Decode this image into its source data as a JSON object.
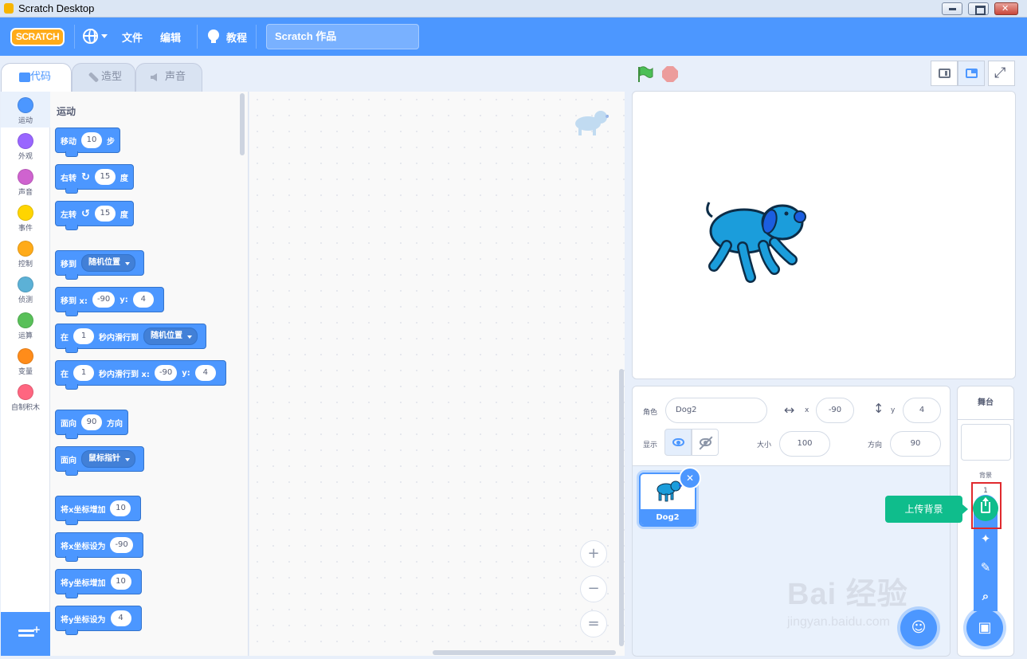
{
  "window": {
    "title": "Scratch Desktop"
  },
  "menubar": {
    "logo_text": "SCRATCH",
    "file_label": "文件",
    "edit_label": "编辑",
    "tutorials_label": "教程",
    "project_title": "Scratch 作品"
  },
  "tabs": {
    "code": "代码",
    "costumes": "造型",
    "sounds": "声音",
    "active": "code"
  },
  "categories": [
    {
      "label": "运动",
      "color": "#4c97ff"
    },
    {
      "label": "外观",
      "color": "#9966ff"
    },
    {
      "label": "声音",
      "color": "#cf63cf"
    },
    {
      "label": "事件",
      "color": "#ffd500"
    },
    {
      "label": "控制",
      "color": "#ffab19"
    },
    {
      "label": "侦测",
      "color": "#5cb1d6"
    },
    {
      "label": "运算",
      "color": "#59c059"
    },
    {
      "label": "变量",
      "color": "#ff8c1a"
    },
    {
      "label": "自制积木",
      "color": "#ff6680"
    }
  ],
  "palette": {
    "section_title": "运动",
    "blocks": {
      "move": {
        "t1": "移动",
        "n1": "10",
        "t2": "步"
      },
      "turn_right": {
        "t1": "右转",
        "icon": "↻",
        "n1": "15",
        "t2": "度"
      },
      "turn_left": {
        "t1": "左转",
        "icon": "↺",
        "n1": "15",
        "t2": "度"
      },
      "goto": {
        "t1": "移到",
        "d1": "随机位置"
      },
      "goto_xy": {
        "t1": "移到 x:",
        "n1": "-90",
        "t2": "y:",
        "n2": "4"
      },
      "glide_to": {
        "t1": "在",
        "n1": "1",
        "t2": "秒内滑行到",
        "d1": "随机位置"
      },
      "glide_xy": {
        "t1": "在",
        "n1": "1",
        "t2": "秒内滑行到 x:",
        "n2": "-90",
        "t3": "y:",
        "n3": "4"
      },
      "point_dir": {
        "t1": "面向",
        "n1": "90",
        "t2": "方向"
      },
      "point_towards": {
        "t1": "面向",
        "d1": "鼠标指针"
      },
      "change_x": {
        "t1": "将x坐标增加",
        "n1": "10"
      },
      "set_x": {
        "t1": "将x坐标设为",
        "n1": "-90"
      },
      "change_y": {
        "t1": "将y坐标增加",
        "n1": "10"
      },
      "set_y": {
        "t1": "将y坐标设为",
        "n1": "4"
      }
    }
  },
  "zoom": {
    "zoom_in": "+",
    "zoom_out": "−",
    "reset": "="
  },
  "sprite_info": {
    "sprite_label": "角色",
    "sprite_name": "Dog2",
    "x_label": "x",
    "x_value": "-90",
    "y_label": "y",
    "y_value": "4",
    "show_label": "显示",
    "size_label": "大小",
    "size_value": "100",
    "direction_label": "方向",
    "direction_value": "90"
  },
  "sprites": [
    {
      "name": "Dog2"
    }
  ],
  "stage_pane": {
    "header": "舞台",
    "backdrops_label": "背景",
    "backdrops_count": "1"
  },
  "backdrop_menu": {
    "tooltip": "上传背景"
  },
  "watermark": {
    "main": "Bai 经验",
    "sub": "jingyan.baidu.com"
  },
  "colors": {
    "accent": "#4c97ff",
    "upload": "#0fbd8c",
    "highlight": "#e0292e",
    "sprite_body": "#1b9ddb",
    "sprite_ear": "#1b5ee0"
  }
}
